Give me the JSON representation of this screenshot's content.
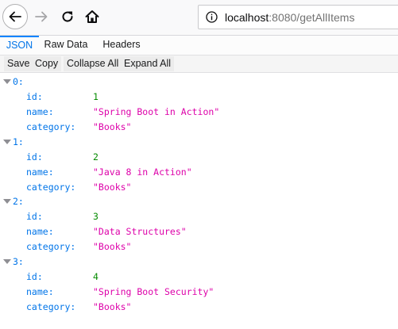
{
  "browser": {
    "url_host": "localhost",
    "url_rest": ":8080/getAllItems"
  },
  "viewer": {
    "tabs": [
      "JSON",
      "Raw Data",
      "Headers"
    ],
    "toolbar": [
      "Save",
      "Copy",
      "Collapse All",
      "Expand All"
    ]
  },
  "colors": {
    "key": "#0074e8",
    "number": "#058b00",
    "string": "#dd00a9",
    "active_tab": "#0a84ff"
  },
  "items": [
    {
      "index": "0:",
      "id_key": "id:",
      "id": "1",
      "name_key": "name:",
      "name": "\"Spring Boot in Action\"",
      "category_key": "category:",
      "category": "\"Books\""
    },
    {
      "index": "1:",
      "id_key": "id:",
      "id": "2",
      "name_key": "name:",
      "name": "\"Java 8 in Action\"",
      "category_key": "category:",
      "category": "\"Books\""
    },
    {
      "index": "2:",
      "id_key": "id:",
      "id": "3",
      "name_key": "name:",
      "name": "\"Data Structures\"",
      "category_key": "category:",
      "category": "\"Books\""
    },
    {
      "index": "3:",
      "id_key": "id:",
      "id": "4",
      "name_key": "name:",
      "name": "\"Spring Boot Security\"",
      "category_key": "category:",
      "category": "\"Books\""
    }
  ]
}
